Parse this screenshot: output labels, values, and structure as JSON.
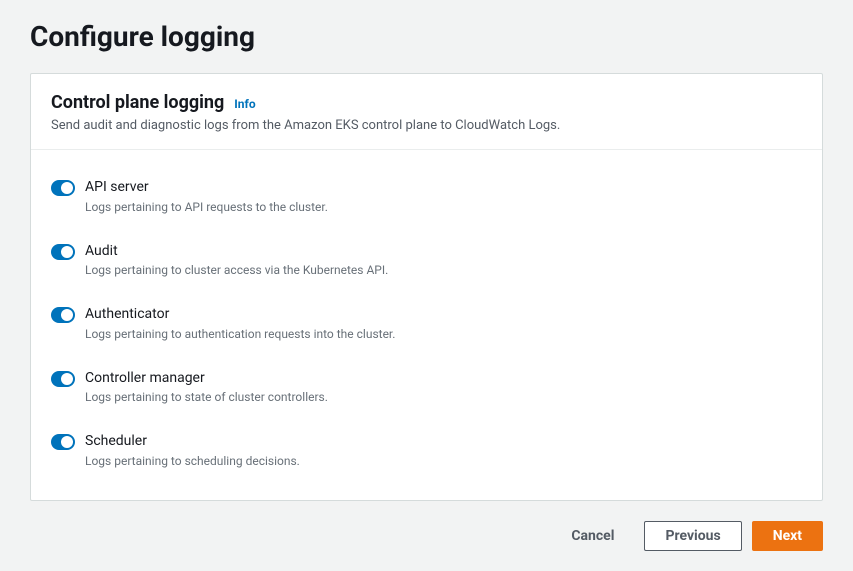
{
  "page": {
    "title": "Configure logging"
  },
  "panel": {
    "title": "Control plane logging",
    "info_label": "Info",
    "description": "Send audit and diagnostic logs from the Amazon EKS control plane to CloudWatch Logs."
  },
  "toggles": [
    {
      "label": "API server",
      "description": "Logs pertaining to API requests to the cluster.",
      "enabled": true
    },
    {
      "label": "Audit",
      "description": "Logs pertaining to cluster access via the Kubernetes API.",
      "enabled": true
    },
    {
      "label": "Authenticator",
      "description": "Logs pertaining to authentication requests into the cluster.",
      "enabled": true
    },
    {
      "label": "Controller manager",
      "description": "Logs pertaining to state of cluster controllers.",
      "enabled": true
    },
    {
      "label": "Scheduler",
      "description": "Logs pertaining to scheduling decisions.",
      "enabled": true
    }
  ],
  "actions": {
    "cancel": "Cancel",
    "previous": "Previous",
    "next": "Next"
  }
}
